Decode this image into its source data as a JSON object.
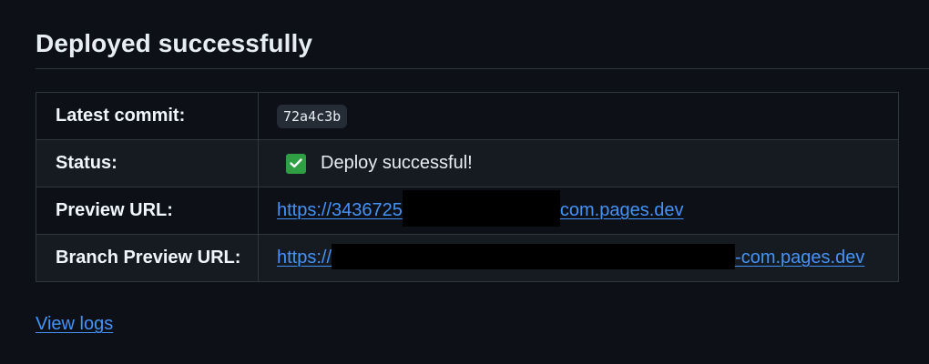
{
  "header": {
    "title": "Deployed successfully"
  },
  "rows": {
    "latest_commit": {
      "label": "Latest commit:",
      "value": "72a4c3b"
    },
    "status": {
      "label": "Status:",
      "value": "Deploy successful!"
    },
    "preview_url": {
      "label": "Preview URL:",
      "prefix": "https://3436725",
      "suffix": "com.pages.dev"
    },
    "branch_preview_url": {
      "label": "Branch Preview URL:",
      "prefix": "https://",
      "suffix": "-com.pages.dev"
    }
  },
  "footer": {
    "view_logs": "View logs"
  },
  "colors": {
    "background": "#0d1117",
    "row_alt": "#161b22",
    "border": "#30363d",
    "link": "#4493f8",
    "success": "#2ea043"
  }
}
